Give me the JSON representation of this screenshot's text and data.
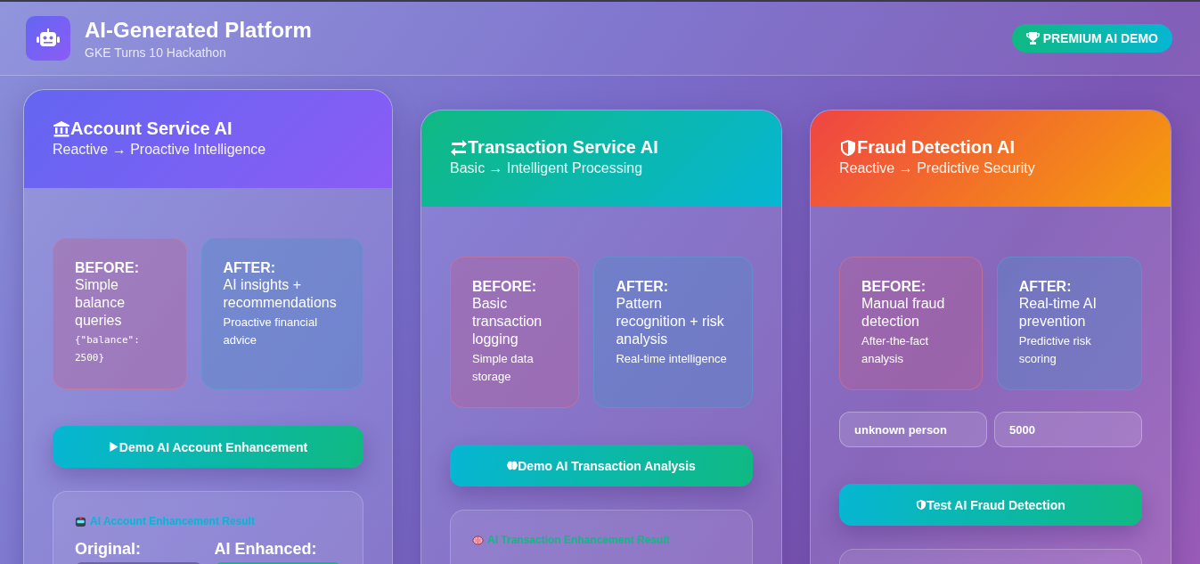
{
  "header": {
    "title": "AI-Generated Platform",
    "subtitle": "GKE Turns 10 Hackathon",
    "badge": "PREMIUM AI DEMO"
  },
  "services": [
    {
      "kind": "account",
      "title": "Account Service AI",
      "subtitle": "Reactive → Proactive Intelligence",
      "before": {
        "label": "BEFORE:",
        "main": "Simple balance queries",
        "code": "{\"balance\": 2500}"
      },
      "after": {
        "label": "AFTER:",
        "main": "AI insights + recommendations",
        "detail": "Proactive financial advice"
      },
      "button": "Demo AI Account Enhancement",
      "result": {
        "title": "AI Account Enhancement Result",
        "labels": [
          "Original:",
          "AI Enhanced:"
        ]
      }
    },
    {
      "kind": "transaction",
      "title": "Transaction Service AI",
      "subtitle": "Basic → Intelligent Processing",
      "before": {
        "label": "BEFORE:",
        "main": "Basic transaction logging",
        "detail": "Simple data storage"
      },
      "after": {
        "label": "AFTER:",
        "main": "Pattern recognition + risk analysis",
        "detail": "Real-time intelligence"
      },
      "button": "Demo AI Transaction Analysis",
      "result": {
        "title": "AI Transaction Enhancement Result"
      }
    },
    {
      "kind": "fraud",
      "title": "Fraud Detection AI",
      "subtitle": "Reactive → Predictive Security",
      "before": {
        "label": "BEFORE:",
        "main": "Manual fraud detection",
        "detail": "After-the-fact analysis"
      },
      "after": {
        "label": "AFTER:",
        "main": "Real-time AI prevention",
        "detail": "Predictive risk scoring"
      },
      "inputs": [
        {
          "value": "unknown person"
        },
        {
          "value": "5000"
        }
      ],
      "button": "Test AI Fraud Detection"
    }
  ]
}
